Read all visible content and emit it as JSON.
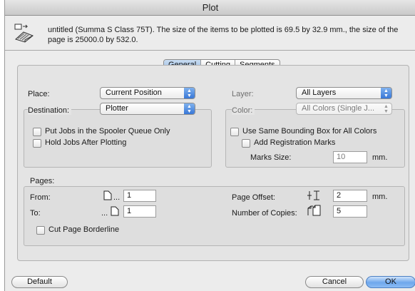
{
  "window": {
    "title": "Plot"
  },
  "info": {
    "text": "untitled (Summa S Class 75T). The size of the items to be plotted is 69.5 by 32.9 mm., the size of the page is 25000.0 by 532.0."
  },
  "tabs": [
    {
      "label": "General",
      "active": true
    },
    {
      "label": "Cutting",
      "active": false
    },
    {
      "label": "Segments",
      "active": false
    }
  ],
  "general": {
    "place_label": "Place:",
    "place_value": "Current Position",
    "destination_label": "Destination:",
    "destination_value": "Plotter",
    "spooler_label": "Put Jobs in the Spooler Queue Only",
    "hold_label": "Hold Jobs After Plotting",
    "layer_label": "Layer:",
    "layer_value": "All Layers",
    "color_label": "Color:",
    "color_value": "All Colors (Single J...",
    "same_bbox_label": "Use Same Bounding Box for All Colors",
    "reg_marks_label": "Add Registration Marks",
    "marks_size_label": "Marks Size:",
    "marks_size_value": "10",
    "marks_size_unit": "mm."
  },
  "pages": {
    "title": "Pages:",
    "from_label": "From:",
    "from_ellipsis": "...",
    "from_value": "1",
    "to_label": "To:",
    "to_ellipsis": "...",
    "to_value": "1",
    "offset_label": "Page Offset:",
    "offset_value": "2",
    "offset_unit": "mm.",
    "copies_label": "Number of Copies:",
    "copies_value": "5",
    "cut_border_label": "Cut Page Borderline"
  },
  "buttons": {
    "default": "Default",
    "cancel": "Cancel",
    "ok": "OK"
  },
  "colors": {
    "accent": "#3877d7",
    "tab_active": "#9dbee4"
  }
}
